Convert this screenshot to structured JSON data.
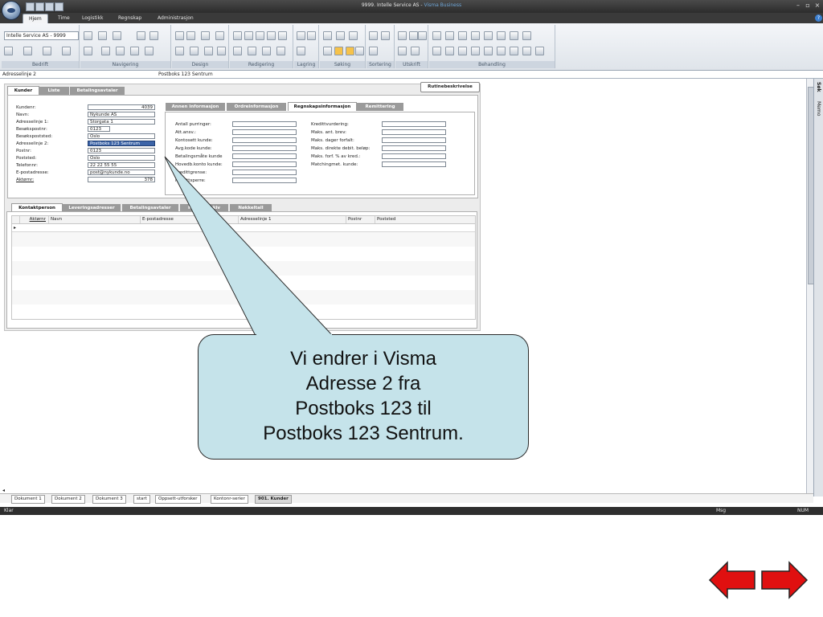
{
  "window": {
    "title_main": "9999. Intelle Service AS - ",
    "title_app": "Visma Business"
  },
  "ribbon": {
    "tabs": [
      {
        "label": "Hjem",
        "active": true
      },
      {
        "label": "Time"
      },
      {
        "label": "Logistikk"
      },
      {
        "label": "Regnskap"
      },
      {
        "label": "Administrasjon"
      }
    ],
    "company_selector": "Intelle Service AS - 9999",
    "groups": [
      "Bedrift",
      "Navigering",
      "Design",
      "Redigering",
      "Lagring",
      "Søking",
      "Sortering",
      "Utskrift",
      "Behandling"
    ]
  },
  "formula_bar": {
    "field_name": "Adresselinje 2",
    "value": "Postboks 123 Sentrum"
  },
  "form": {
    "top_tabs": [
      "Kunder",
      "Liste",
      "Betalingsavtaler"
    ],
    "routine_button": "Rutinebeskrivelse",
    "customer_fields": [
      {
        "label": "Kundenr:",
        "value": "4039",
        "align": "right"
      },
      {
        "label": "Navn:",
        "value": "Nykunde AS"
      },
      {
        "label": "Adresselinje 1:",
        "value": "Storgata 1"
      },
      {
        "label": "Besøkspostnr:",
        "value": "0123"
      },
      {
        "label": "Besøkspoststed:",
        "value": "Oslo"
      },
      {
        "label": "Adresselinje 2:",
        "value": "Postboks 123 Sentrum",
        "selected": true
      },
      {
        "label": "Postnr:",
        "value": "0123"
      },
      {
        "label": "Poststed:",
        "value": "Oslo"
      },
      {
        "label": "Telefonnr:",
        "value": "22 22 55 55"
      },
      {
        "label": "E-postadresse:",
        "value": "post@nykunde.no"
      },
      {
        "label": "Aktørnr:",
        "value": "378",
        "align": "right"
      }
    ],
    "info_tabs": [
      "Annen informasjon",
      "Ordreinformasjon",
      "Regnskapsinformasjon",
      "Remittering"
    ],
    "left_fields": [
      "Antall purringer:",
      "Att.ansv.:",
      "Kontosett kunde:",
      "Avg.kode kunde:",
      "Betalingsmåte kunde",
      "Hovedb.konto kunde:",
      "Kredittgrense:",
      "Kredittsperre:"
    ],
    "right_fields": [
      "Kredittvurdering:",
      "Maks. ant. brev:",
      "Maks. dager forfalt:",
      "Maks. direkte debit. beløp:",
      "Maks. forf. % av kred.:",
      "Matchingmet. kunde:"
    ],
    "sub_tabs": [
      "Kontaktperson",
      "Leveringsadresser",
      "Betalingsavtaler",
      "Kontaktarkiv",
      "Nøkkeltall"
    ],
    "grid_headers": [
      "Aktørnr",
      "Navn",
      "E-postadresse",
      "Adresselinje 1",
      "Postnr",
      "Poststed"
    ]
  },
  "doc_tabs": [
    {
      "label": "Dokument 1"
    },
    {
      "label": "Dokument 2"
    },
    {
      "label": "Dokument 3"
    },
    {
      "label": "start"
    },
    {
      "label": "Oppsett-utforsker"
    },
    {
      "label": "Kontonr-serier"
    },
    {
      "label": "901. Kunder",
      "active": true
    }
  ],
  "status": {
    "left": "Klar",
    "msg": "Msg",
    "num": "NUM"
  },
  "side_panel": {
    "label1": "Søk",
    "label2": "Memo"
  },
  "callout": {
    "lines": [
      "Vi endrer i Visma",
      "Adresse 2 fra",
      "Postboks 123 til",
      "Postboks 123 Sentrum."
    ]
  },
  "colors": {
    "callout_fill": "#c5e3ea",
    "arrow_red": "#e01010",
    "selection_blue": "#3c64a8"
  }
}
